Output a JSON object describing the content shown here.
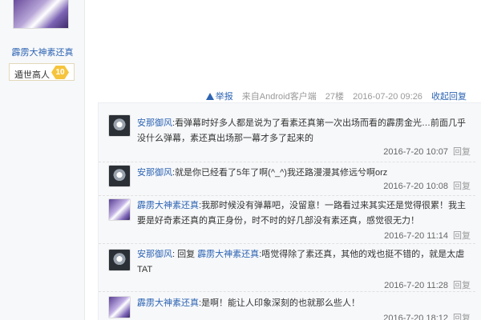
{
  "profile": {
    "username": "霹雳大神素还真",
    "level_name": "遁世高人",
    "level": "10"
  },
  "post_tail": {
    "report": "举报",
    "source": "来自Android客户端",
    "floor": "27楼",
    "datetime": "2016-07-20 09:26",
    "collapse": "收起回复"
  },
  "replies": [
    {
      "user": "安那御风",
      "colon": ":",
      "text": "看弹幕时好多人都是说为了看素还真第一次出场而看的霹雳金光…前面几乎没什么弹幕，素还真出场那一幕才多了起来的",
      "time": "2016-7-20 10:07",
      "reply": "回复",
      "avatar": "bw"
    },
    {
      "user": "安那御风",
      "colon": ":",
      "text": "就是你已经看了5年了啊(^_^)我还路漫漫其修远兮啊orz",
      "time": "2016-7-20 10:08",
      "reply": "回复",
      "avatar": "bw"
    },
    {
      "user": "霹雳大神素还真",
      "colon": ":",
      "text": "我那时候没有弹幕吧，没留意！一路看过来其实还是觉得很累！我主要是好奇素还真的真正身份，时不时的好几部没有素还真，感觉很无力！",
      "time": "2016-7-20 11:14",
      "reply": "回复",
      "avatar": "color"
    },
    {
      "user": "安那御风",
      "colon": ":",
      "prefix": "回复",
      "mention": "霹雳大神素还真",
      "text": ":唔觉得除了素还真，其他的戏也挺不错的，就是太虐TAT",
      "time": "2016-7-20 11:28",
      "reply": "回复",
      "avatar": "bw"
    },
    {
      "user": "霹雳大神素还真",
      "colon": ":",
      "text": "是啊！能让人印象深刻的也就那么些人！",
      "time": "2016-7-20 18:12",
      "reply": "回复",
      "avatar": "color"
    }
  ]
}
